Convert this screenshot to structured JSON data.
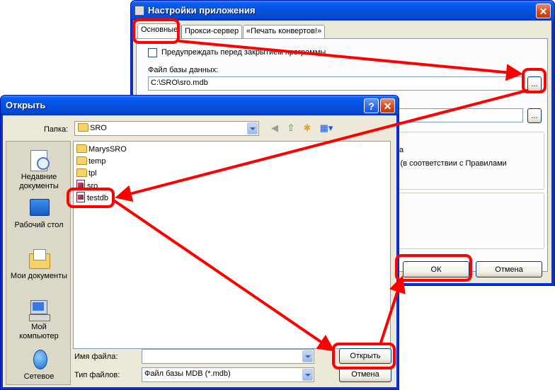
{
  "settings_dialog": {
    "title": "Настройки приложения",
    "tabs": [
      "Основные",
      "Прокси-сервер",
      "«Печать конвертов!»"
    ],
    "warn_checkbox_label": "Предупреждать перед закрытием программы",
    "db_file_label": "Файл базы данных:",
    "db_file_value": "C:\\SRO\\sro.mdb",
    "browse_label": "...",
    "browse2_label": "...",
    "partial_text_1": "а",
    "partial_text_2": "с (в соответствии с Правилами",
    "ok_label": "ОК",
    "cancel_label": "Отмена"
  },
  "open_dialog": {
    "title": "Открыть",
    "help_label": "?",
    "look_in_label": "Папка:",
    "look_in_value": "SRO",
    "places": [
      {
        "icon": "recent-documents-icon",
        "line1": "Недавние",
        "line2": "документы"
      },
      {
        "icon": "desktop-icon",
        "line1": "Рабочий стол",
        "line2": ""
      },
      {
        "icon": "my-documents-icon",
        "line1": "Мои документы",
        "line2": ""
      },
      {
        "icon": "my-computer-icon",
        "line1": "Мой",
        "line2": "компьютер"
      },
      {
        "icon": "network-icon",
        "line1": "Сетевое",
        "line2": ""
      }
    ],
    "files": [
      {
        "name": "MarysSRO",
        "type": "folder"
      },
      {
        "name": "temp",
        "type": "folder"
      },
      {
        "name": "tpl",
        "type": "folder"
      },
      {
        "name": "sro",
        "type": "mdb"
      },
      {
        "name": "testdb",
        "type": "mdb"
      }
    ],
    "filename_label": "Имя файла:",
    "filename_value": "",
    "filetype_label": "Тип файлов:",
    "filetype_value": "Файл базы MDB (*.mdb)",
    "open_label": "Открыть",
    "cancel_label": "Отмена"
  },
  "colors": {
    "annotation": "#ff0000",
    "xp_blue": "#0550e0",
    "dialog_bg": "#ece9d8"
  }
}
